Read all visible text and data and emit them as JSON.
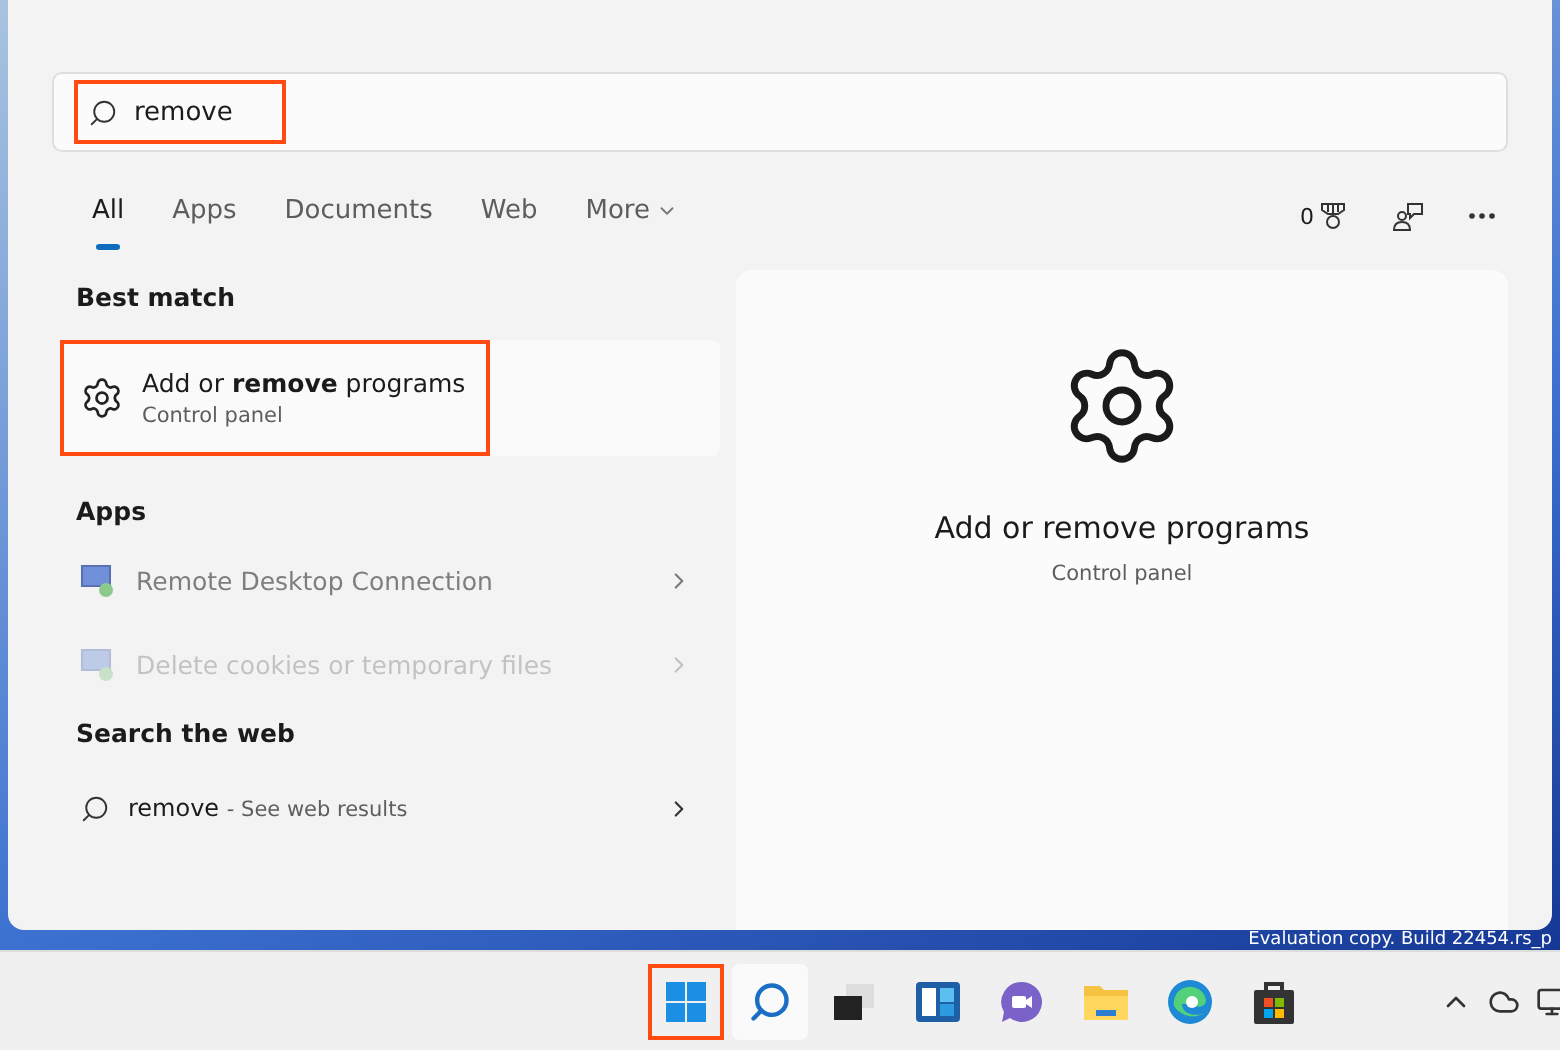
{
  "search": {
    "value": "remove",
    "highlighted": true
  },
  "tabs": [
    {
      "label": "All",
      "selected": true,
      "kind": "tab"
    },
    {
      "label": "Apps",
      "selected": false,
      "kind": "tab"
    },
    {
      "label": "Documents",
      "selected": false,
      "kind": "tab"
    },
    {
      "label": "Web",
      "selected": false,
      "kind": "tab"
    },
    {
      "label": "More",
      "selected": false,
      "kind": "menu"
    }
  ],
  "toolbar": {
    "points": "0"
  },
  "best_match": {
    "heading": "Best match",
    "item": {
      "title": "Add or **remove** programs",
      "subtitle": "Control panel",
      "highlighted": true
    }
  },
  "apps": {
    "heading": "Apps",
    "items": [
      {
        "label": "Remote Desktop Connection",
        "faded": false
      },
      {
        "label": "Delete cookies or temporary files",
        "faded": true
      }
    ]
  },
  "web": {
    "heading": "Search the web",
    "item": {
      "query": "remove",
      "suffix": "- See web results"
    }
  },
  "preview": {
    "title": "Add or remove programs",
    "subtitle": "Control panel"
  },
  "desktop": {
    "watermark": "Evaluation copy. Build 22454.rs_p"
  },
  "taskbar": {
    "start_highlighted": true
  }
}
